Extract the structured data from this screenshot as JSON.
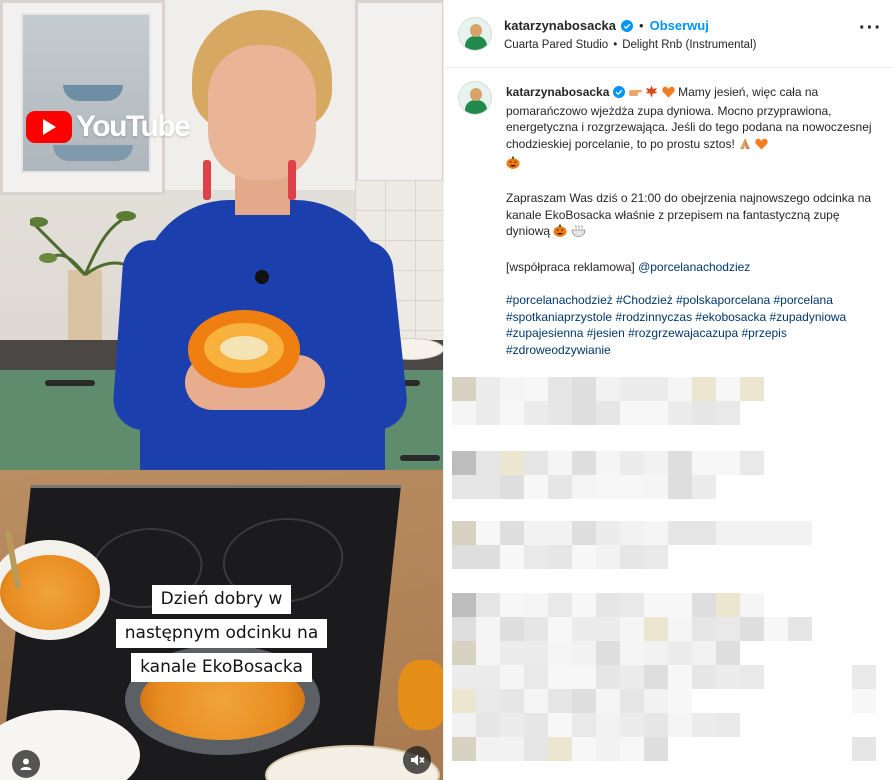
{
  "video": {
    "watermark": "YouTube",
    "subtitle_lines": [
      "Dzień dobry w",
      "następnym odcinku na",
      "kanale EkoBosacka"
    ],
    "user_icon": "user-tag-icon",
    "mute_icon": "speaker-muted-icon"
  },
  "header": {
    "username": "katarzynabosacka",
    "separator": "•",
    "follow_label": "Obserwuj",
    "location": "Cuarta Pared Studio",
    "audio_separator": "•",
    "audio": "Delight Rnb (Instrumental)",
    "more_icon": "more-options-icon",
    "more_symbol": "···"
  },
  "caption": {
    "username": "katarzynabosacka",
    "paragraph1": "Mamy jesień, więc cała na pomarańczowo wjeżdża zupa dyniowa. Mocno przyprawiona, energetyczna i rozgrzewająca. Jeśli do tego podana na nowoczesnej chodzieskiej porcelanie, to po prostu sztos!",
    "paragraph2": "Zapraszam Was dziś o 21:00 do obejrzenia najnowszego odcinka na kanale EkoBosacka właśnie z przepisem na fantastyczną zupę dyniową",
    "paragraph3_prefix": "[współpraca reklamowa]",
    "paragraph3_mention": "@porcelanachodziez",
    "hashtags": "#porcelanachodzież #Chodzież #polskaporcelana #porcelana #spotkaniaprzystole #rodzinnyczas #ekobosacka #zupadyniowa #zupajesienna #jesien #rozgrzewajacazupa #przepis #zdroweodzywianie"
  },
  "colors": {
    "link": "#0095f6",
    "hashtag": "#00376b",
    "verified": "#0095f6",
    "youtube_red": "#ff0000"
  }
}
